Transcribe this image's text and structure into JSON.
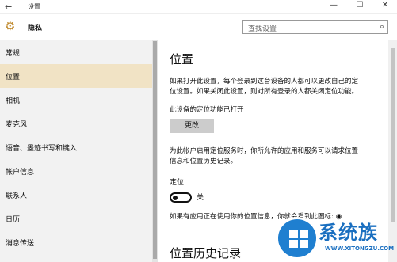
{
  "window": {
    "back_glyph": "←",
    "title": "设置",
    "min_glyph": "—",
    "max_glyph": "☐",
    "close_glyph": "✕"
  },
  "header": {
    "icon": "gear-icon",
    "title": "隐私",
    "search_placeholder": "查找设置",
    "search_icon": "search-icon"
  },
  "sidebar": {
    "items": [
      {
        "label": "常规",
        "active": false
      },
      {
        "label": "位置",
        "active": true
      },
      {
        "label": "相机",
        "active": false
      },
      {
        "label": "麦克风",
        "active": false
      },
      {
        "label": "语音、墨迹书写和键入",
        "active": false
      },
      {
        "label": "帐户信息",
        "active": false
      },
      {
        "label": "联系人",
        "active": false
      },
      {
        "label": "日历",
        "active": false
      },
      {
        "label": "消息传送",
        "active": false
      }
    ]
  },
  "main": {
    "title": "位置",
    "desc_line1": "如果打开此设置，每个登录到这台设备的人都可以更改自己的定",
    "desc_line2": "位设置。如果关闭此设置，则对所有登录的人都关闭定位功能。",
    "status": "此设备的定位功能已打开",
    "change_button": "更改",
    "account_line1": "为此帐户启用定位服务时，你所允许的应用和服务可以请求位置",
    "account_line2": "信息和位置历史记录。",
    "location_label": "定位",
    "toggle_state": "关",
    "toggle_on": false,
    "icon_note": "如果有应用正在使用你的位置信息，你就会看到此图标:",
    "icon_glyph": "◉",
    "history_title": "位置历史记录"
  },
  "watermark": {
    "name": "系统族",
    "url": "WWW.XITONGZU.COM"
  },
  "colors": {
    "accent_active": "#f1e3c5",
    "sidebar_bg": "#f2f2f2",
    "button_bg": "#cccccc",
    "gear": "#c08a2e",
    "watermark_blue": "#1a6fc0"
  }
}
